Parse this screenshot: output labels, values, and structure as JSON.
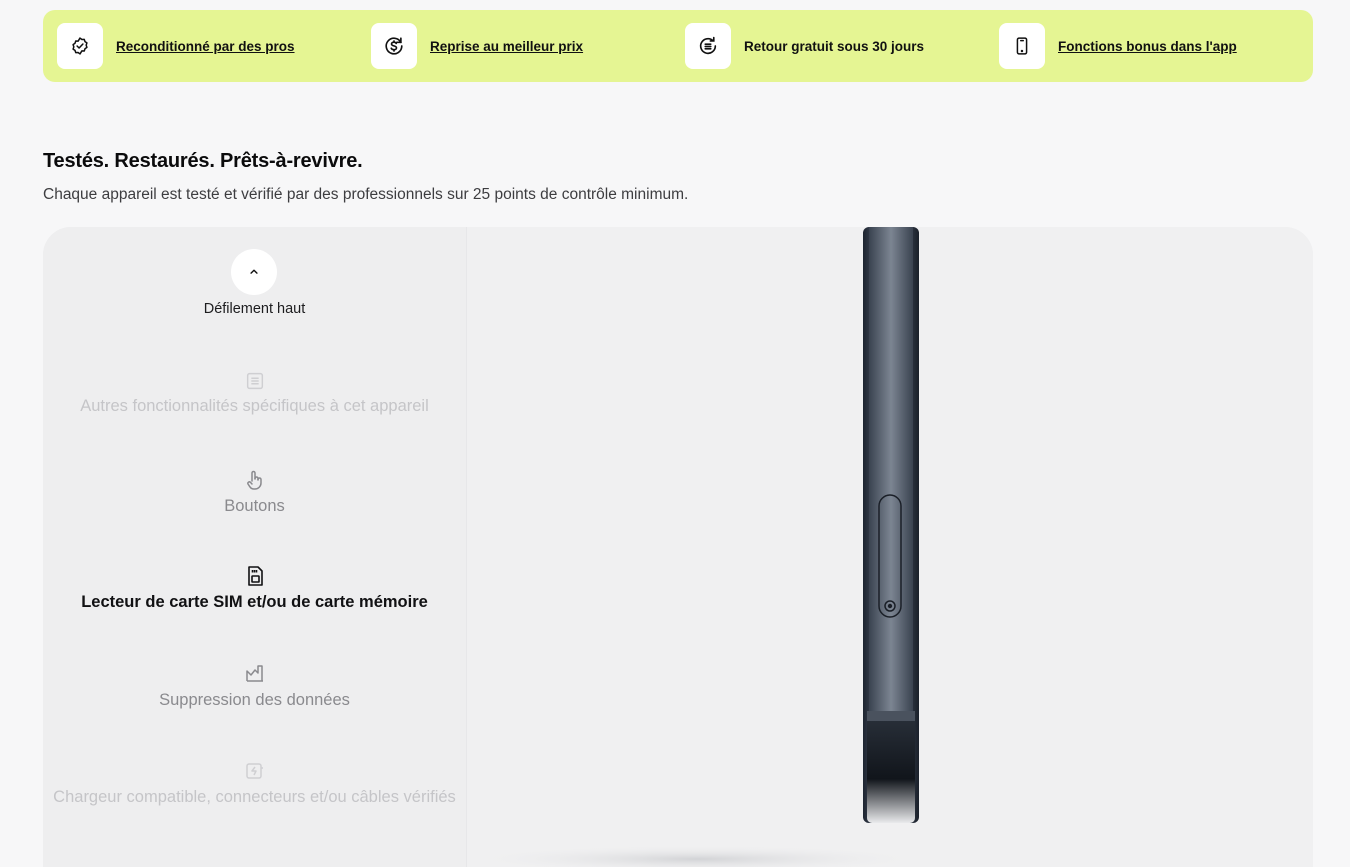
{
  "features": [
    {
      "label": "Reconditionné par des pros",
      "icon": "badge-check-icon",
      "link": true
    },
    {
      "label": "Reprise au meilleur prix",
      "icon": "dollar-refresh-icon",
      "link": true
    },
    {
      "label": "Retour gratuit sous 30 jours",
      "icon": "return-cycle-icon",
      "link": false
    },
    {
      "label": "Fonctions bonus dans l'app",
      "icon": "smartphone-icon",
      "link": true
    }
  ],
  "section": {
    "title": "Testés. Restaurés. Prêts-à-revivre.",
    "subtitle": "Chaque appareil est testé et vérifié par des professionnels sur 25 points de contrôle minimum."
  },
  "carousel": {
    "scroll_up_label": "Défilement haut",
    "items": [
      {
        "label": "Autres fonctionnalités spécifiques à cet appareil",
        "icon": "list-icon",
        "state": "faint"
      },
      {
        "label": "Boutons",
        "icon": "hand-pointer-icon",
        "state": "mid"
      },
      {
        "label": "Lecteur de carte SIM et/ou de carte mémoire",
        "icon": "sim-card-icon",
        "state": "active"
      },
      {
        "label": "Suppression des données",
        "icon": "chart-erase-icon",
        "state": "mid"
      },
      {
        "label": "Chargeur compatible, connecteurs et/ou câbles vérifiés",
        "icon": "charger-icon",
        "state": "faint"
      }
    ]
  },
  "colors": {
    "banner": "#e5f593",
    "page": "#f7f7f8",
    "panel": "#efeff0",
    "phone_frame": "#2a3340"
  }
}
